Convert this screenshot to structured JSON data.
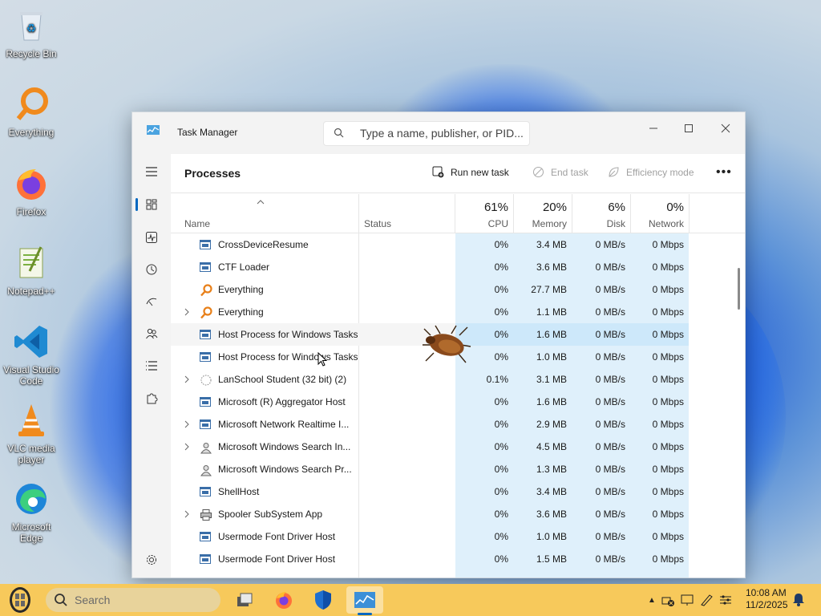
{
  "desktop": {
    "icons": [
      {
        "label": "Recycle Bin",
        "icon": "recycle-bin-icon"
      },
      {
        "label": "Everything",
        "icon": "everything-search-icon"
      },
      {
        "label": "Firefox",
        "icon": "firefox-icon"
      },
      {
        "label": "Notepad++",
        "icon": "notepad-plus-plus-icon"
      },
      {
        "label": "Visual Studio Code",
        "icon": "vscode-icon"
      },
      {
        "label": "VLC media player",
        "icon": "vlc-icon"
      },
      {
        "label": "Microsoft Edge",
        "icon": "edge-icon"
      }
    ]
  },
  "window": {
    "title": "Task Manager",
    "search_placeholder": "Type a name, publisher, or PID...",
    "toolbar": {
      "title": "Processes",
      "run_new_task": "Run new task",
      "end_task": "End task",
      "efficiency_mode": "Efficiency mode"
    },
    "columns": {
      "name": "Name",
      "status": "Status",
      "cpu": {
        "pct": "61%",
        "label": "CPU"
      },
      "memory": {
        "pct": "20%",
        "label": "Memory"
      },
      "disk": {
        "pct": "6%",
        "label": "Disk"
      },
      "network": {
        "pct": "0%",
        "label": "Network"
      }
    },
    "rows": [
      {
        "name": "CrossDeviceResume",
        "expandable": false,
        "icon": "window-process-icon",
        "cpu": "0%",
        "memory": "3.4 MB",
        "disk": "0 MB/s",
        "network": "0 Mbps"
      },
      {
        "name": "CTF Loader",
        "expandable": false,
        "icon": "window-process-icon",
        "cpu": "0%",
        "memory": "3.6 MB",
        "disk": "0 MB/s",
        "network": "0 Mbps"
      },
      {
        "name": "Everything",
        "expandable": false,
        "icon": "everything-search-icon",
        "cpu": "0%",
        "memory": "27.7 MB",
        "disk": "0 MB/s",
        "network": "0 Mbps"
      },
      {
        "name": "Everything",
        "expandable": true,
        "icon": "everything-search-icon",
        "cpu": "0%",
        "memory": "1.1 MB",
        "disk": "0 MB/s",
        "network": "0 Mbps"
      },
      {
        "name": "Host Process for Windows Tasks",
        "expandable": false,
        "icon": "window-process-icon",
        "cpu": "0%",
        "memory": "1.6 MB",
        "disk": "0 MB/s",
        "network": "0 Mbps",
        "hovered": true
      },
      {
        "name": "Host Process for Windows Tasks",
        "expandable": false,
        "icon": "window-process-icon",
        "cpu": "0%",
        "memory": "1.0 MB",
        "disk": "0 MB/s",
        "network": "0 Mbps"
      },
      {
        "name": "LanSchool Student (32 bit) (2)",
        "expandable": true,
        "icon": "lanschool-icon",
        "cpu": "0.1%",
        "memory": "3.1 MB",
        "disk": "0 MB/s",
        "network": "0 Mbps"
      },
      {
        "name": "Microsoft (R) Aggregator Host",
        "expandable": false,
        "icon": "window-process-icon",
        "cpu": "0%",
        "memory": "1.6 MB",
        "disk": "0 MB/s",
        "network": "0 Mbps"
      },
      {
        "name": "Microsoft Network Realtime I...",
        "expandable": true,
        "icon": "window-process-icon",
        "cpu": "0%",
        "memory": "2.9 MB",
        "disk": "0 MB/s",
        "network": "0 Mbps"
      },
      {
        "name": "Microsoft Windows Search In...",
        "expandable": true,
        "icon": "search-user-icon",
        "cpu": "0%",
        "memory": "4.5 MB",
        "disk": "0 MB/s",
        "network": "0 Mbps"
      },
      {
        "name": "Microsoft Windows Search Pr...",
        "expandable": false,
        "icon": "search-user-icon",
        "cpu": "0%",
        "memory": "1.3 MB",
        "disk": "0 MB/s",
        "network": "0 Mbps"
      },
      {
        "name": "ShellHost",
        "expandable": false,
        "icon": "window-process-icon",
        "cpu": "0%",
        "memory": "3.4 MB",
        "disk": "0 MB/s",
        "network": "0 Mbps"
      },
      {
        "name": "Spooler SubSystem App",
        "expandable": true,
        "icon": "printer-icon",
        "cpu": "0%",
        "memory": "3.6 MB",
        "disk": "0 MB/s",
        "network": "0 Mbps"
      },
      {
        "name": "Usermode Font Driver Host",
        "expandable": false,
        "icon": "window-process-icon",
        "cpu": "0%",
        "memory": "1.0 MB",
        "disk": "0 MB/s",
        "network": "0 Mbps"
      },
      {
        "name": "Usermode Font Driver Host",
        "expandable": false,
        "icon": "window-process-icon",
        "cpu": "0%",
        "memory": "1.5 MB",
        "disk": "0 MB/s",
        "network": "0 Mbps"
      }
    ]
  },
  "taskbar": {
    "search_placeholder": "Search",
    "time": "10:08 AM",
    "date": "11/2/2025"
  },
  "colors": {
    "heat": "#dff0fb",
    "taskbar": "#f7c95b",
    "accent": "#0067c0"
  }
}
